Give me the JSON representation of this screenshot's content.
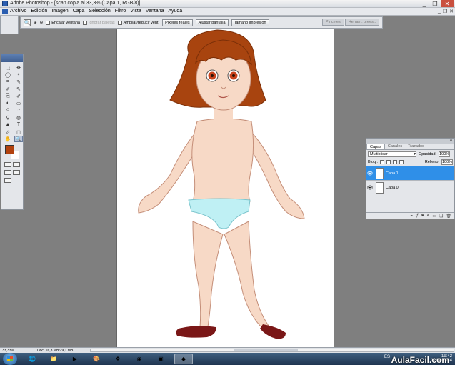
{
  "window": {
    "title": "Adobe Photoshop - [scan copia al 33,3% (Capa 1, RGB/8)]",
    "controls": [
      "_",
      "❐",
      "✕"
    ]
  },
  "menubar": {
    "items": [
      "Archivo",
      "Edición",
      "Imagen",
      "Capa",
      "Selección",
      "Filtro",
      "Vista",
      "Ventana",
      "Ayuda"
    ],
    "doc_controls": [
      "_",
      "❐",
      "✕"
    ]
  },
  "options_bar": {
    "zoom_in_icon": "⊕",
    "zoom_out_icon": "⊖",
    "encajar_label": "Encajar ventana",
    "ignorar_label": "Ignorar paletas",
    "ampliar_label": "Ampliar/reducir vent.",
    "pixeles_reales": "Píxeles reales",
    "ajustar_pantalla": "Ajustar pantalla",
    "tamano_impresion": "Tamaño impresión",
    "tabs": [
      "Pinceles",
      "Herram. preest."
    ]
  },
  "toolbox": {
    "tools": [
      "⬚",
      "✥",
      "◯",
      "⌖",
      "⌗",
      "✎",
      "✐",
      "✎",
      "⎘",
      "✐",
      "◐",
      "⛀",
      "◊",
      "◔",
      "⚲",
      "◍",
      "▲",
      "T",
      "⬀",
      "◻",
      "✋",
      "🔍"
    ],
    "fg_color": "#b2420f",
    "bg_color": "#ffffff"
  },
  "layers_panel": {
    "tabs": [
      "Capas",
      "Canales",
      "Trazados"
    ],
    "blend_mode": "Multiplicar",
    "opacity_label": "Opacidad:",
    "opacity_value": "100%",
    "lock_label": "Bloq.:",
    "fill_label": "Relleno:",
    "fill_value": "100%",
    "layers": [
      {
        "name": "Capa 1",
        "selected": true
      },
      {
        "name": "Capa 0",
        "selected": false
      }
    ]
  },
  "statusbar": {
    "zoom": "33,33%",
    "doc": "Doc: 16,3 MB/29,1 MB"
  },
  "taskbar": {
    "lang": "ES",
    "time": "19:42",
    "date": "11/04/2014"
  },
  "watermark": "AulaFacil.com",
  "colors": {
    "accent": "#2f8fe8",
    "hair": "#a8440f",
    "skin": "#f7d9c6",
    "underwear": "#bff0f4",
    "shoes": "#7a1717"
  }
}
